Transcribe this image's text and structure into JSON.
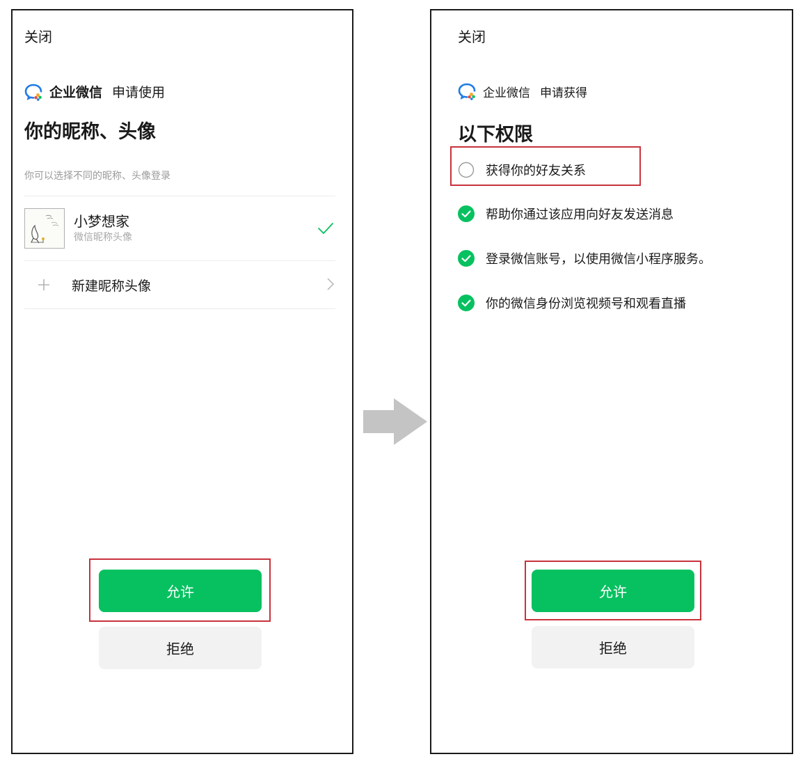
{
  "left_screen": {
    "close_label": "关闭",
    "app_name": "企业微信",
    "app_action": "申请使用",
    "heading": "你的昵称、头像",
    "hint": "你可以选择不同的昵称、头像登录",
    "profile": {
      "name": "小梦想家",
      "subtitle": "微信昵称头像"
    },
    "new_profile_label": "新建昵称头像",
    "allow_label": "允许",
    "deny_label": "拒绝"
  },
  "right_screen": {
    "close_label": "关闭",
    "app_name": "企业微信",
    "app_action": "申请获得",
    "heading": "以下权限",
    "permissions": [
      {
        "label": "获得你的好友关系",
        "checked": false
      },
      {
        "label": "帮助你通过该应用向好友发送消息",
        "checked": true
      },
      {
        "label": "登录微信账号，以使用微信小程序服务。",
        "checked": true
      },
      {
        "label": "你的微信身份浏览视频号和观看直播",
        "checked": true
      }
    ],
    "allow_label": "允许",
    "deny_label": "拒绝"
  },
  "colors": {
    "wechat_green": "#07c160",
    "highlight_red": "#c8323c",
    "arrow_gray": "#c4c4c4"
  },
  "icons": {
    "app_logo": "wecom-logo-icon",
    "check": "check-icon",
    "plus": "plus-icon",
    "chevron": "chevron-right-icon",
    "checked_circle": "checked-circle-icon",
    "empty_circle": "empty-circle-icon",
    "transition_arrow": "arrow-right-icon"
  }
}
